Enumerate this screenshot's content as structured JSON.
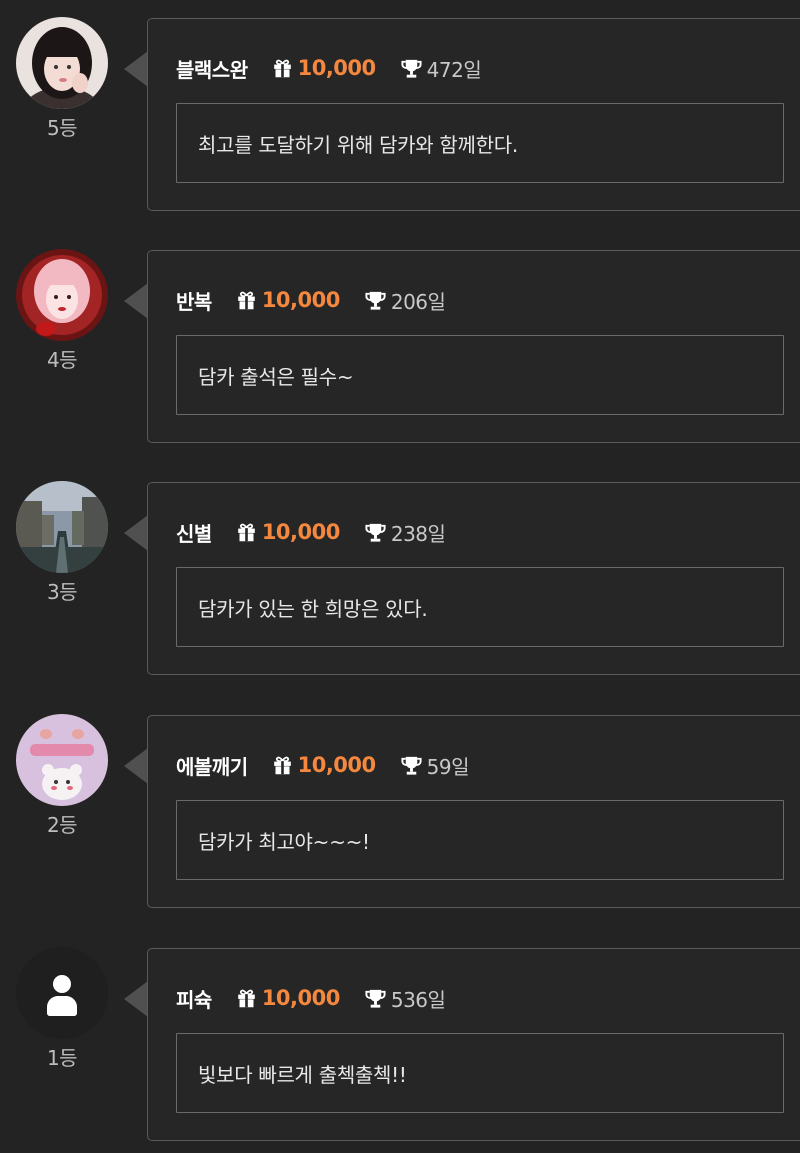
{
  "entries": [
    {
      "nickname": "블랙스완",
      "gift_amount": "10,000",
      "days": "472일",
      "message": "최고를 도달하기 위해 담카와 함께한다.",
      "rank": "5등"
    },
    {
      "nickname": "반복",
      "gift_amount": "10,000",
      "days": "206일",
      "message": "담카 출석은 필수~",
      "rank": "4등"
    },
    {
      "nickname": "신별",
      "gift_amount": "10,000",
      "days": "238일",
      "message": "담카가 있는 한 희망은 있다.",
      "rank": "3등"
    },
    {
      "nickname": "에볼깨기",
      "gift_amount": "10,000",
      "days": "59일",
      "message": "담카가 최고야~~~!",
      "rank": "2등"
    },
    {
      "nickname": "피슉",
      "gift_amount": "10,000",
      "days": "536일",
      "message": "빛보다 빠르게 출첵출첵!!",
      "rank": "1등"
    }
  ],
  "icons": {
    "gift": "gift-icon",
    "trophy": "trophy-icon",
    "default_avatar": "user-silhouette-icon"
  },
  "colors": {
    "background": "#232323",
    "accent": "#f5883f"
  }
}
